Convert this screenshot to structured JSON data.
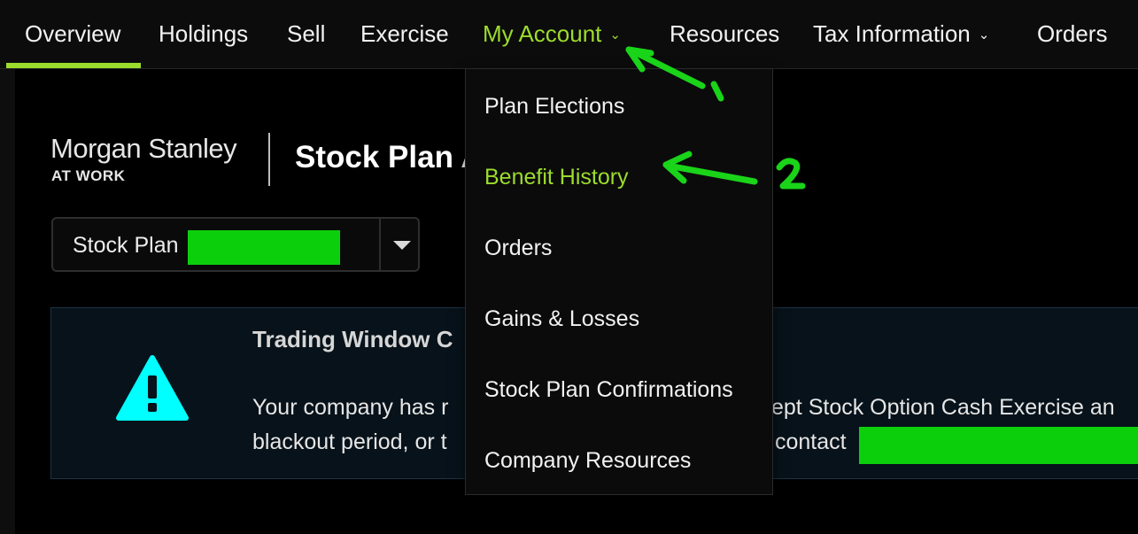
{
  "nav": {
    "items": [
      {
        "label": "Overview"
      },
      {
        "label": "Holdings"
      },
      {
        "label": "Sell"
      },
      {
        "label": "Exercise"
      },
      {
        "label": "My Account"
      },
      {
        "label": "Resources"
      },
      {
        "label": "Tax Information"
      },
      {
        "label": "Orders"
      }
    ],
    "active": "Overview",
    "open_menu": "My Account",
    "accent_color": "#9cdc2c"
  },
  "brand": {
    "name": "Morgan Stanley",
    "sub": "AT WORK"
  },
  "page": {
    "title": "Stock Plan A"
  },
  "plan_select": {
    "label": "Stock Plan"
  },
  "alert": {
    "title": "Trading Window C",
    "line1_left": "Your company has r",
    "line1_right": "ept Stock Option Cash Exercise an",
    "line2_left": "blackout period, or t",
    "line2_right": "contact",
    "icon": "warning-icon",
    "icon_color": "#00ffff"
  },
  "dropdown": {
    "items": [
      {
        "label": "Plan Elections"
      },
      {
        "label": "Benefit History"
      },
      {
        "label": "Orders"
      },
      {
        "label": "Gains & Losses"
      },
      {
        "label": "Stock Plan Confirmations"
      },
      {
        "label": "Company Resources"
      }
    ],
    "highlighted": "Benefit History"
  },
  "annotations": {
    "marker_1": "1",
    "marker_2": "2",
    "color": "#19d419"
  }
}
